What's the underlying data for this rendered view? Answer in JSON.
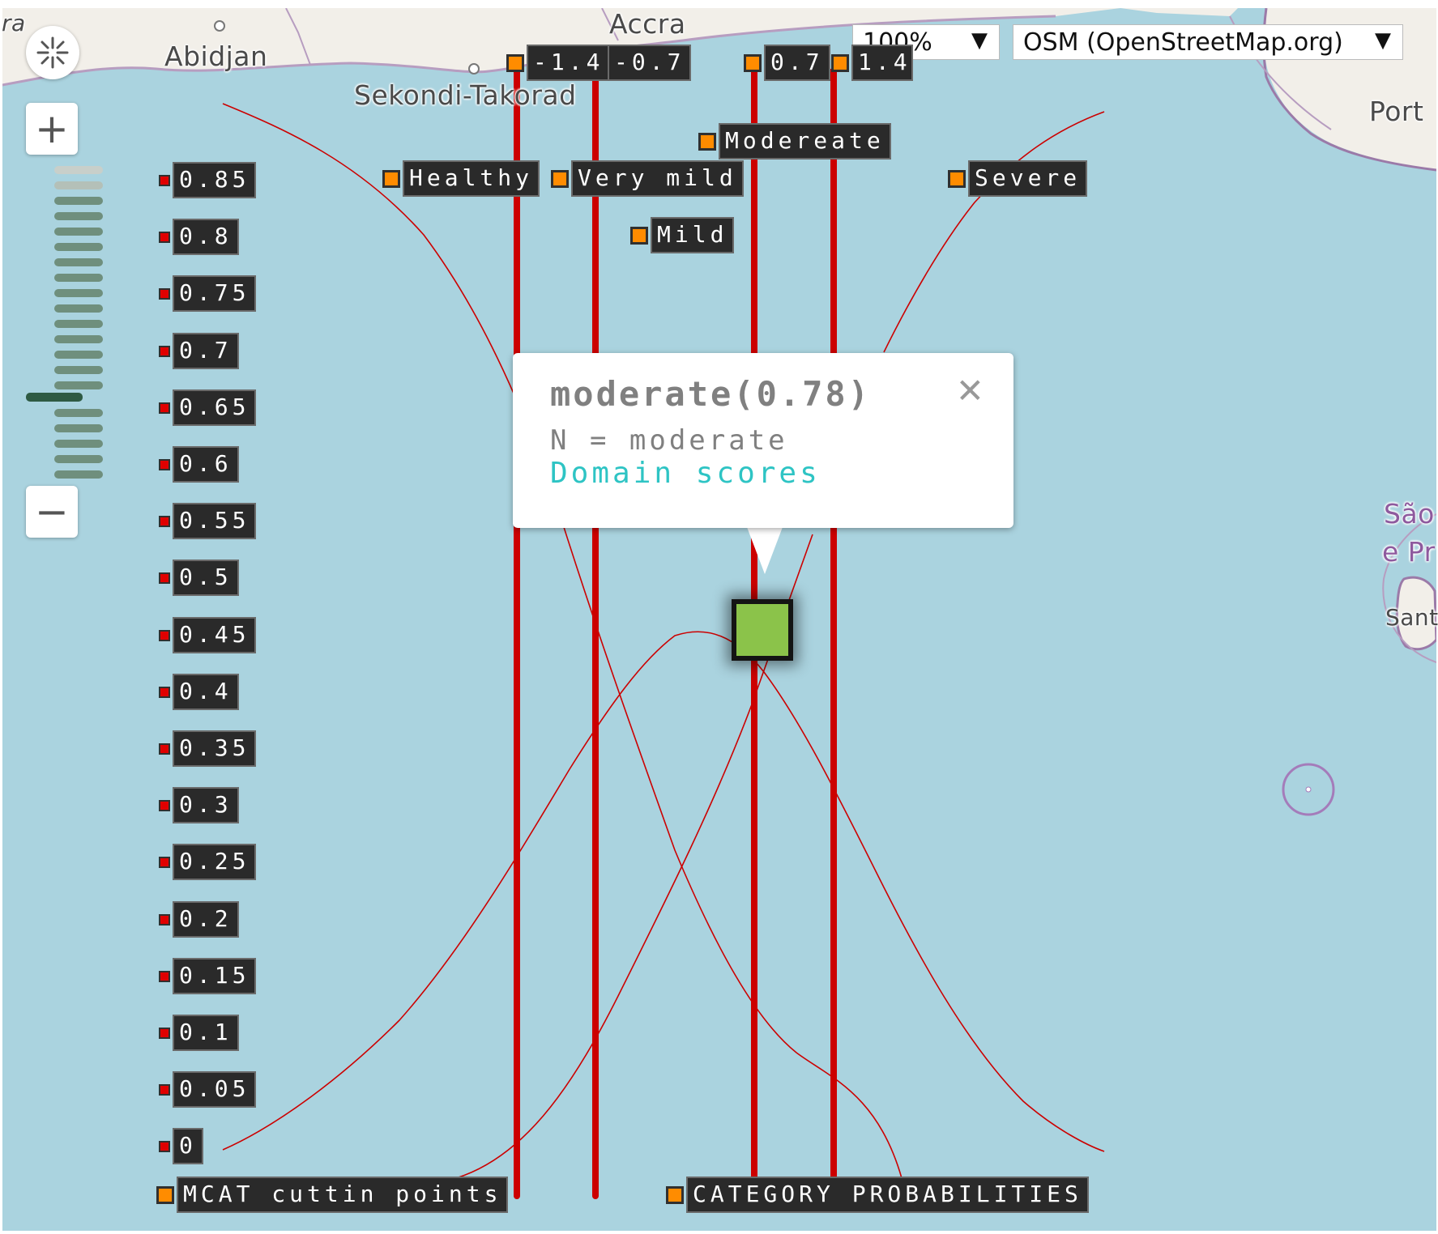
{
  "map": {
    "places": [
      {
        "name": "Abidjan"
      },
      {
        "name": "Accra"
      },
      {
        "name": "Sekondi-Takorad"
      },
      {
        "name": "Port"
      },
      {
        "name": "São"
      },
      {
        "name": "e Pr"
      },
      {
        "name": "Sant"
      },
      {
        "name": "ra"
      }
    ],
    "colors": {
      "water": "#aad3df",
      "land": "#f2efe9",
      "cutpoint_line": "#cc0000",
      "curve": "#d40000",
      "marker": "#ff8c00"
    }
  },
  "controls": {
    "zoom_in_label": "+",
    "zoom_out_label": "−",
    "center_icon": "crosshair-icon",
    "opacity_value": "100%",
    "layer_value": "OSM (OpenStreetMap.org)",
    "dropdown_arrow": "▼"
  },
  "markers": {
    "cut_values": [
      "-1.4",
      "-0.7",
      "0.7",
      "1.4"
    ],
    "categories": [
      "Healthy",
      "Very mild",
      "Modereate",
      "Mild",
      "Severe"
    ],
    "y_axis": [
      "0.85",
      "0.8",
      "0.75",
      "0.7",
      "0.65",
      "0.6",
      "0.55",
      "0.5",
      "0.45",
      "0.4",
      "0.35",
      "0.3",
      "0.25",
      "0.2",
      "0.15",
      "0.1",
      "0.05",
      "0"
    ],
    "bottom": [
      "MCAT cuttin points",
      "CATEGORY PROBABILITIES"
    ]
  },
  "popup": {
    "title": "moderate(0.78)",
    "line": "N = moderate",
    "link": "Domain scores",
    "close": "✕"
  }
}
